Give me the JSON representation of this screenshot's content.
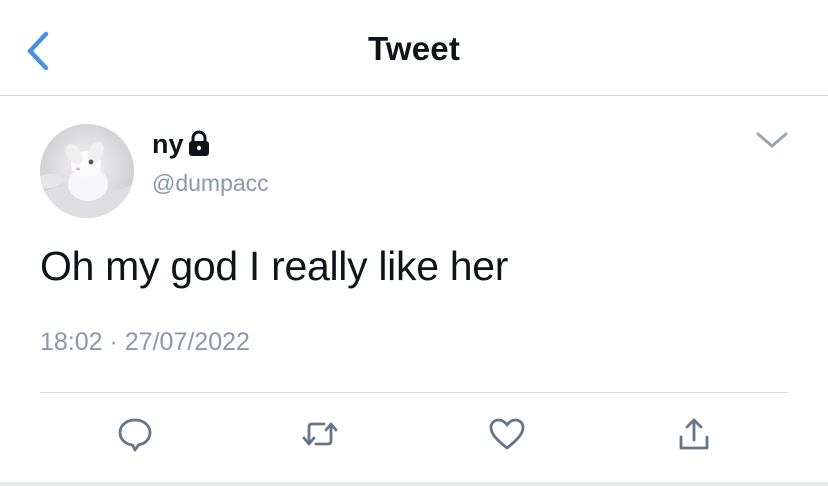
{
  "header": {
    "title": "Tweet",
    "back_icon": "chevron-left-icon",
    "accent_color": "#4a90e2"
  },
  "tweet": {
    "display_name": "ny",
    "protected_icon": "lock-icon",
    "handle": "@dumpacc",
    "text": "Oh my god I really like her",
    "time": "18:02",
    "separator": "·",
    "date": "27/07/2022",
    "menu_icon": "chevron-down-icon"
  },
  "actions": [
    {
      "icon": "reply-icon"
    },
    {
      "icon": "retweet-icon"
    },
    {
      "icon": "like-icon"
    },
    {
      "icon": "share-icon"
    }
  ],
  "colors": {
    "text": "#0f1419",
    "secondary": "#8b98a5",
    "icon": "#657786"
  }
}
